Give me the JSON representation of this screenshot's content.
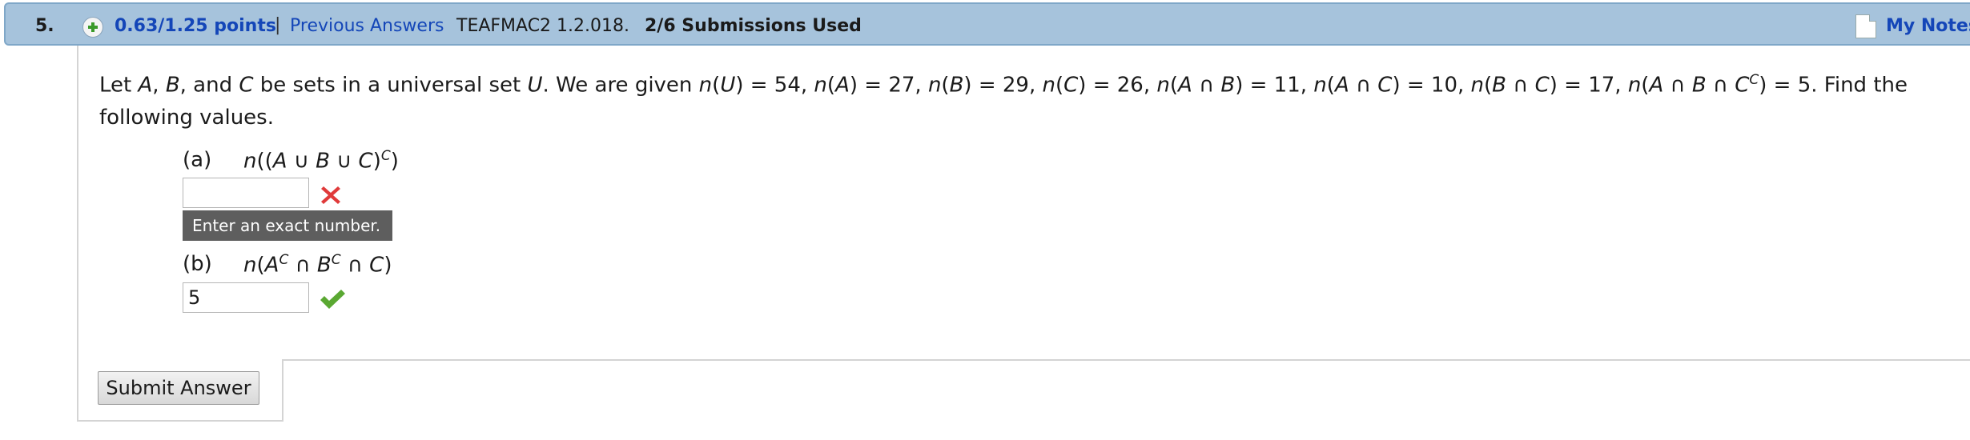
{
  "header": {
    "question_number": "5.",
    "points": "0.63/1.25 points",
    "separator": "|",
    "previous_answers": "Previous Answers",
    "problem_code": "TEAFMAC2 1.2.018.",
    "submissions": "2/6 Submissions Used",
    "my_notes": "My Notes",
    "icons": [
      "plus-icon",
      "notes-icon"
    ]
  },
  "problem": {
    "intro": "Let A, B, and C be sets in a universal set U. We are given n(U) = 54, n(A) = 27, n(B) = 29, n(C) = 26, n(A ∩ B) = 11, n(A ∩ C) = 10, n(B ∩ C) = 17, n(A ∩ B ∩ C^C) = 5. Find the following values."
  },
  "parts": [
    {
      "label": "(a)",
      "expression": "n((A ∪ B ∪ C)^C)",
      "value": "",
      "status": "incorrect",
      "status_icon": "cross-icon",
      "tooltip": "Enter an exact number."
    },
    {
      "label": "(b)",
      "expression": "n(A^C ∩ B^C ∩ C)",
      "value": "5",
      "status": "correct",
      "status_icon": "check-icon"
    }
  ],
  "submit_label": "Submit Answer",
  "colors": {
    "header_bg": "#a6c3dc",
    "link": "#1446b8",
    "incorrect": "#e03a3a",
    "correct": "#5aa832",
    "tooltip_bg": "#5e5e5e"
  }
}
